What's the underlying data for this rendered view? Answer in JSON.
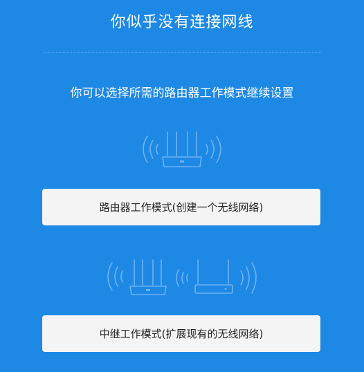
{
  "page": {
    "title": "你似乎没有连接网线",
    "subtitle": "你可以选择所需的路由器工作模式继续设置"
  },
  "modes": {
    "router_button_label": "路由器工作模式(创建一个无线网络)",
    "repeater_button_label": "中继工作模式(扩展现有的无线网络)"
  },
  "icons": {
    "router_illustration": "router-wifi-icon",
    "repeater_illustration": "repeater-wifi-icon"
  },
  "colors": {
    "background": "#1e88e5",
    "button_background": "#f4f4f4",
    "button_text": "#222222",
    "illustration_stroke": "#6fb3f2"
  }
}
